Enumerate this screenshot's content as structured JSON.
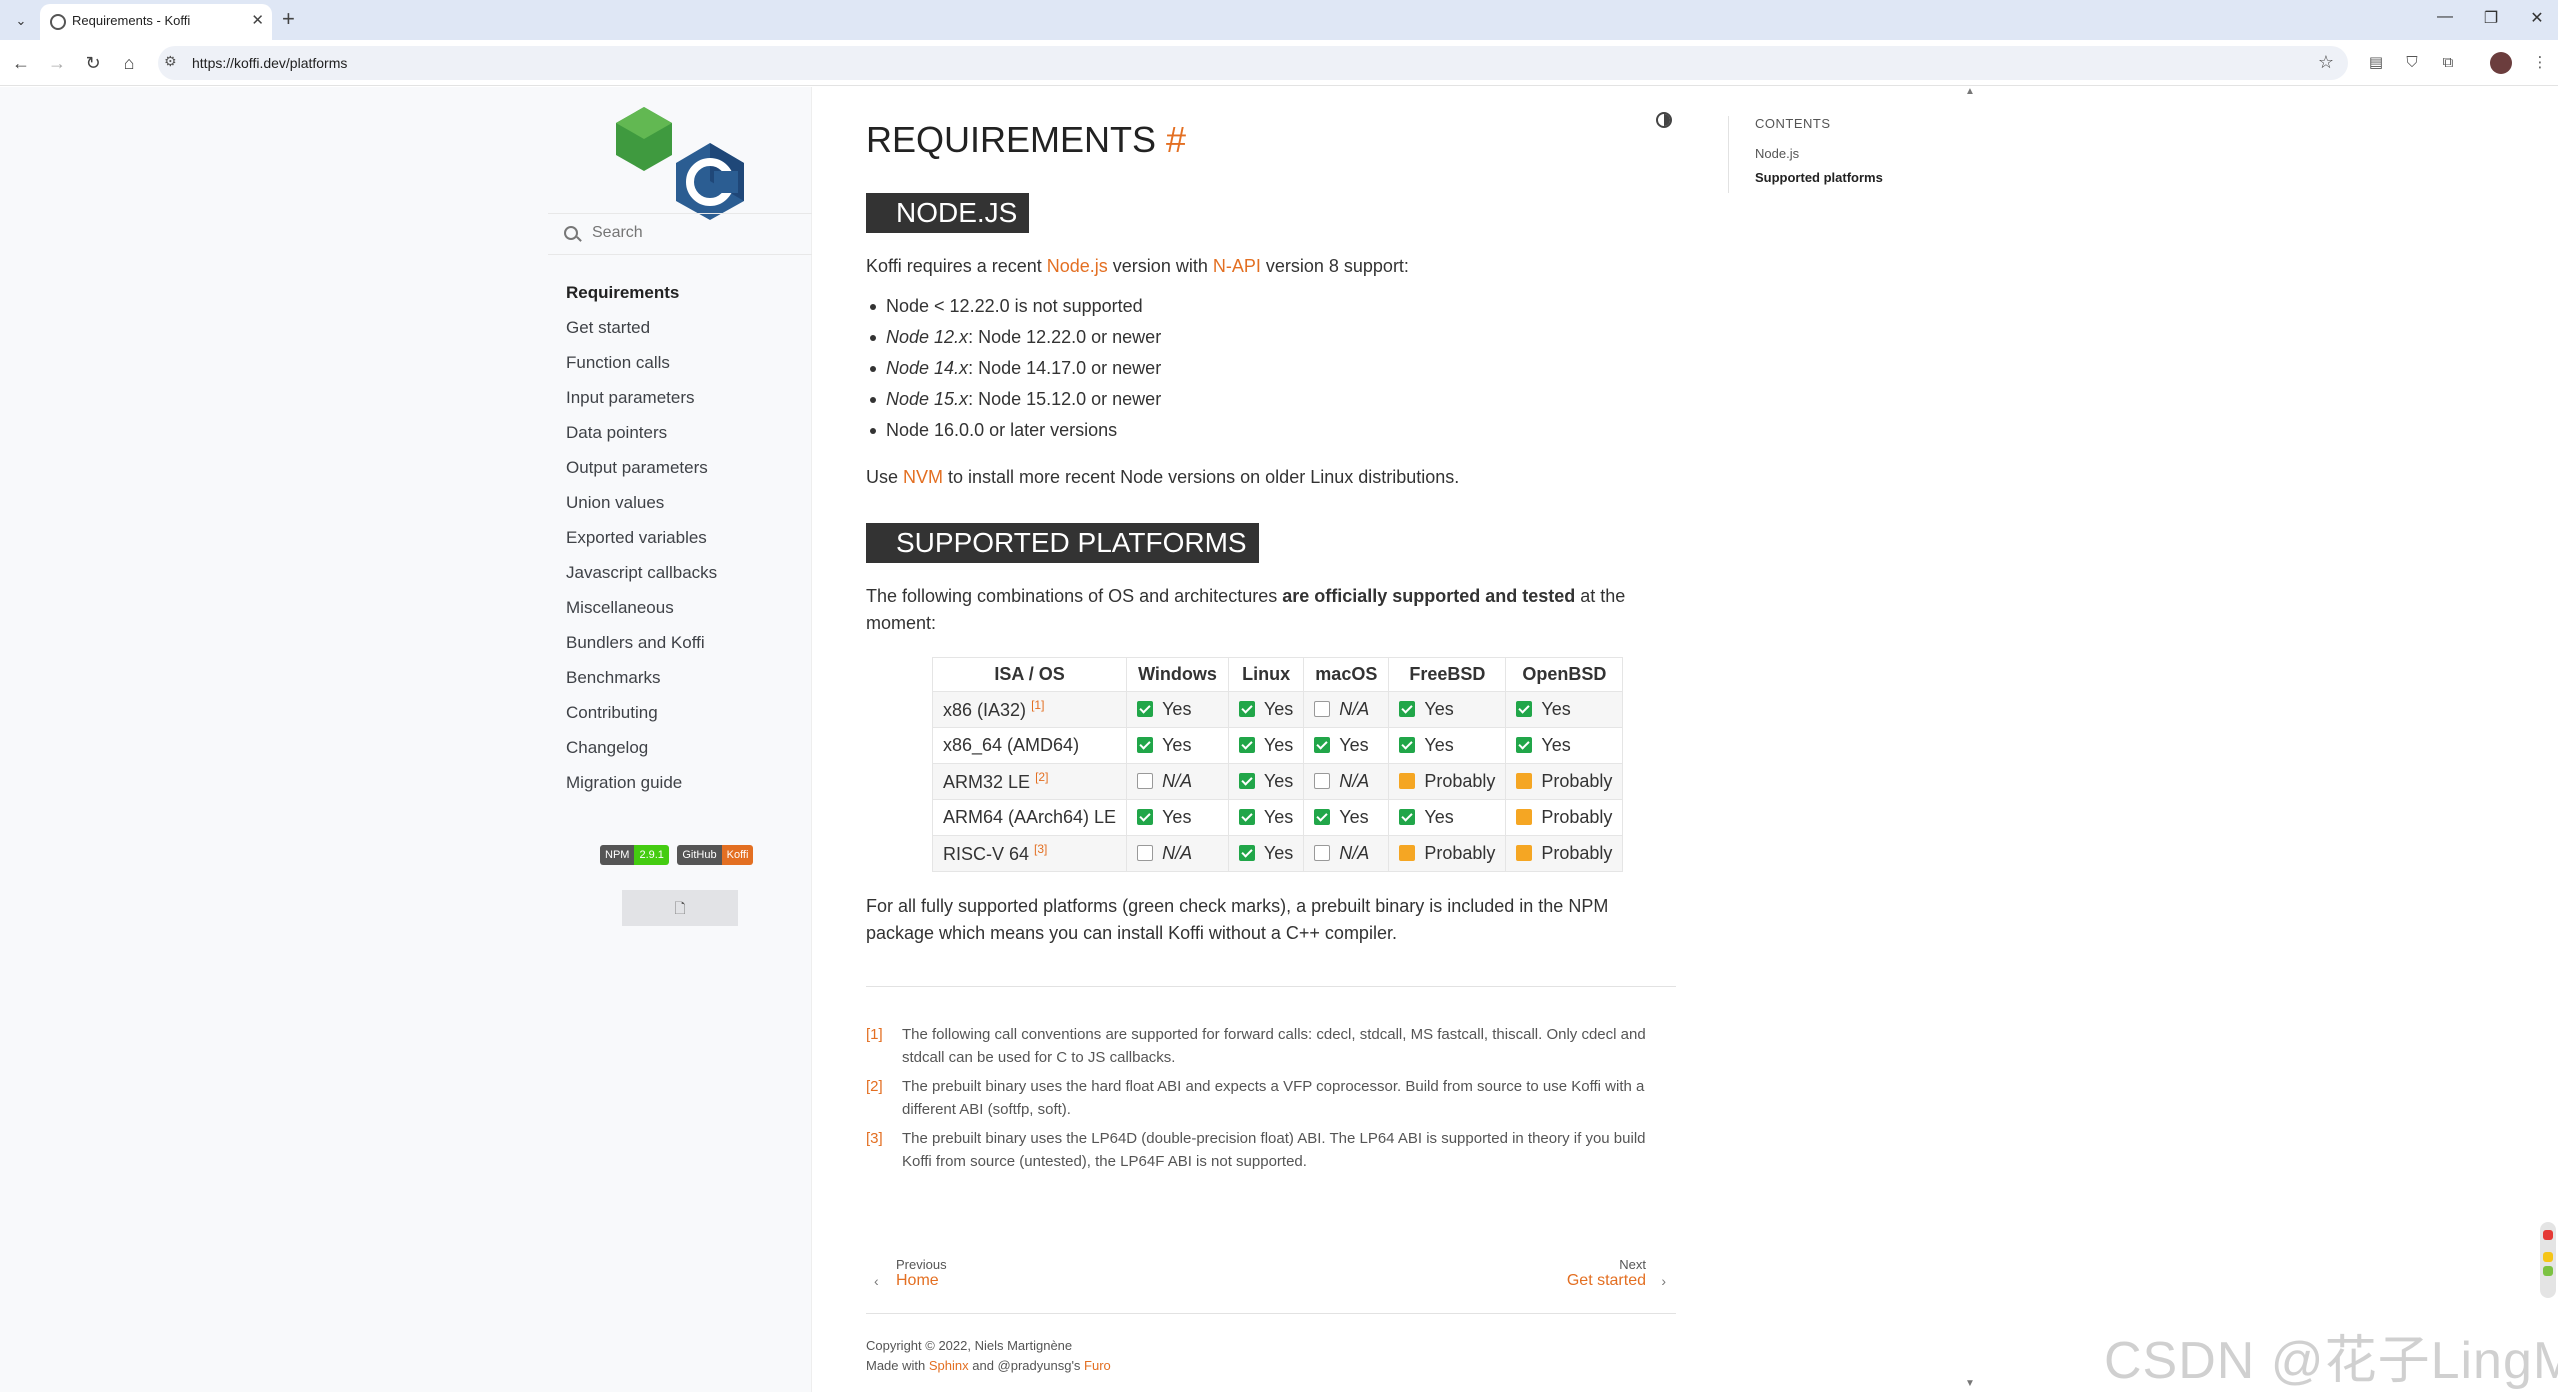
{
  "browser": {
    "tab_title": "Requirements - Koffi",
    "url": "https://koffi.dev/platforms",
    "tab_close": "✕",
    "new_tab": "+",
    "win_min": "—",
    "win_restore": "❐",
    "win_close": "✕"
  },
  "search": {
    "placeholder": "Search"
  },
  "sidebar": {
    "items": [
      "Requirements",
      "Get started",
      "Function calls",
      "Input parameters",
      "Data pointers",
      "Output parameters",
      "Union values",
      "Exported variables",
      "Javascript callbacks",
      "Miscellaneous",
      "Bundlers and Koffi",
      "Benchmarks",
      "Contributing",
      "Changelog",
      "Migration guide"
    ],
    "active_index": 0,
    "badges": [
      {
        "key": "NPM",
        "value": "2.9.1",
        "color": "#44cc11"
      },
      {
        "key": "GitHub",
        "value": "Koffi",
        "color": "#e36f22"
      }
    ]
  },
  "content": {
    "title": "REQUIREMENTS",
    "title_anchor": "#",
    "node_heading": "NODE.JS",
    "node_intro": {
      "pre": "Koffi requires a recent ",
      "link1": "Node.js",
      "mid": " version with ",
      "link2": "N-API",
      "post": " version 8 support:"
    },
    "node_bullets": [
      {
        "em": "",
        "text": "Node < 12.22.0 is not supported"
      },
      {
        "em": "Node 12.x",
        "text": ": Node 12.22.0 or newer"
      },
      {
        "em": "Node 14.x",
        "text": ": Node 14.17.0 or newer"
      },
      {
        "em": "Node 15.x",
        "text": ": Node 15.12.0 or newer"
      },
      {
        "em": "",
        "text": "Node 16.0.0 or later versions"
      }
    ],
    "nvm_line": {
      "pre": "Use ",
      "link": "NVM",
      "post": " to install more recent Node versions on older Linux distributions."
    },
    "platforms_heading": "SUPPORTED PLATFORMS",
    "platforms_intro": {
      "pre": "The following combinations of OS and architectures ",
      "strong": "are officially supported and tested",
      "post": " at the moment:"
    },
    "table": {
      "headers": [
        "ISA / OS",
        "Windows",
        "Linux",
        "macOS",
        "FreeBSD",
        "OpenBSD"
      ],
      "rows": [
        {
          "isa": "x86 (IA32)",
          "ref": "[1]",
          "cells": [
            [
              "yes",
              "Yes"
            ],
            [
              "yes",
              "Yes"
            ],
            [
              "na",
              "N/A"
            ],
            [
              "yes",
              "Yes"
            ],
            [
              "yes",
              "Yes"
            ]
          ]
        },
        {
          "isa": "x86_64 (AMD64)",
          "ref": "",
          "cells": [
            [
              "yes",
              "Yes"
            ],
            [
              "yes",
              "Yes"
            ],
            [
              "yes",
              "Yes"
            ],
            [
              "yes",
              "Yes"
            ],
            [
              "yes",
              "Yes"
            ]
          ]
        },
        {
          "isa": "ARM32 LE",
          "ref": "[2]",
          "cells": [
            [
              "na",
              "N/A"
            ],
            [
              "yes",
              "Yes"
            ],
            [
              "na",
              "N/A"
            ],
            [
              "prob",
              "Probably"
            ],
            [
              "prob",
              "Probably"
            ]
          ]
        },
        {
          "isa": "ARM64 (AArch64) LE",
          "ref": "",
          "cells": [
            [
              "yes",
              "Yes"
            ],
            [
              "yes",
              "Yes"
            ],
            [
              "yes",
              "Yes"
            ],
            [
              "yes",
              "Yes"
            ],
            [
              "prob",
              "Probably"
            ]
          ]
        },
        {
          "isa": "RISC-V 64",
          "ref": "[3]",
          "cells": [
            [
              "na",
              "N/A"
            ],
            [
              "yes",
              "Yes"
            ],
            [
              "na",
              "N/A"
            ],
            [
              "prob",
              "Probably"
            ],
            [
              "prob",
              "Probably"
            ]
          ]
        }
      ]
    },
    "prebuilt_note": "For all fully supported platforms (green check marks), a prebuilt binary is included in the NPM package which means you can install Koffi without a C++ compiler.",
    "footnotes": [
      {
        "num": "[1]",
        "text": "The following call conventions are supported for forward calls: cdecl, stdcall, MS fastcall, thiscall. Only cdecl and stdcall can be used for C to JS callbacks."
      },
      {
        "num": "[2]",
        "text": "The prebuilt binary uses the hard float ABI and expects a VFP coprocessor. Build from source to use Koffi with a different ABI (softfp, soft)."
      },
      {
        "num": "[3]",
        "text": "The prebuilt binary uses the LP64D (double-precision float) ABI. The LP64 ABI is supported in theory if you build Koffi from source (untested), the LP64F ABI is not supported."
      }
    ],
    "prev": {
      "label": "Previous",
      "title": "Home"
    },
    "next": {
      "label": "Next",
      "title": "Get started"
    },
    "footer": {
      "copyright": "Copyright © 2022, Niels Martignène",
      "made_pre": "Made with ",
      "made_link1": "Sphinx",
      "made_mid": " and @pradyunsg's ",
      "made_link2": "Furo"
    }
  },
  "toc": {
    "title": "CONTENTS",
    "items": [
      "Node.js",
      "Supported platforms"
    ],
    "active_index": 1
  },
  "watermark": "CSDN @花子LingMo",
  "colors": {
    "accent": "#e36f22",
    "check": "#21a649",
    "probably": "#f5a623",
    "heading_bg": "#333333"
  }
}
